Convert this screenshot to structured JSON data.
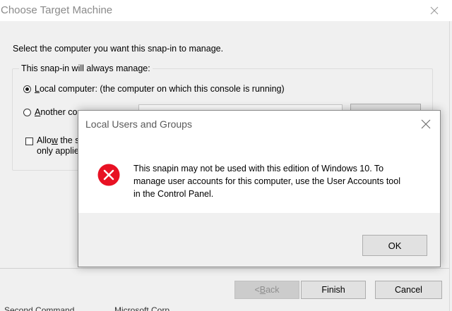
{
  "back_window": {
    "title": "Choose Target Machine",
    "instruction": "Select the computer you want this snap-in to manage.",
    "group_label": "This snap-in will always manage:",
    "local_radio": {
      "accel": "L",
      "label_rest": "ocal computer:  (the computer on which this console is running)",
      "checked": true
    },
    "another_radio": {
      "accel": "A",
      "label_rest": "nother co",
      "checked": false
    },
    "allow_checkbox": {
      "accel": "w",
      "line1_pre": "Allo",
      "line1_post": " the s",
      "line2": "only applie",
      "checked": false
    },
    "buttons": {
      "back_pre": "< ",
      "back_accel": "B",
      "back_post": "ack",
      "finish": "Finish",
      "cancel": "Cancel"
    },
    "behind_text": {
      "left": "Second Command",
      "right": "Microsoft Corp"
    }
  },
  "dialog": {
    "title": "Local Users and Groups",
    "message_lines": [
      "This snapin may not be used with this edition of Windows 10. To",
      "manage user accounts for this computer, use the User Accounts tool",
      "in the Control Panel."
    ],
    "ok_label": "OK",
    "icon": "error-icon",
    "colors": {
      "error_red": "#e81123",
      "footer_bg": "#f0f0f0"
    }
  }
}
